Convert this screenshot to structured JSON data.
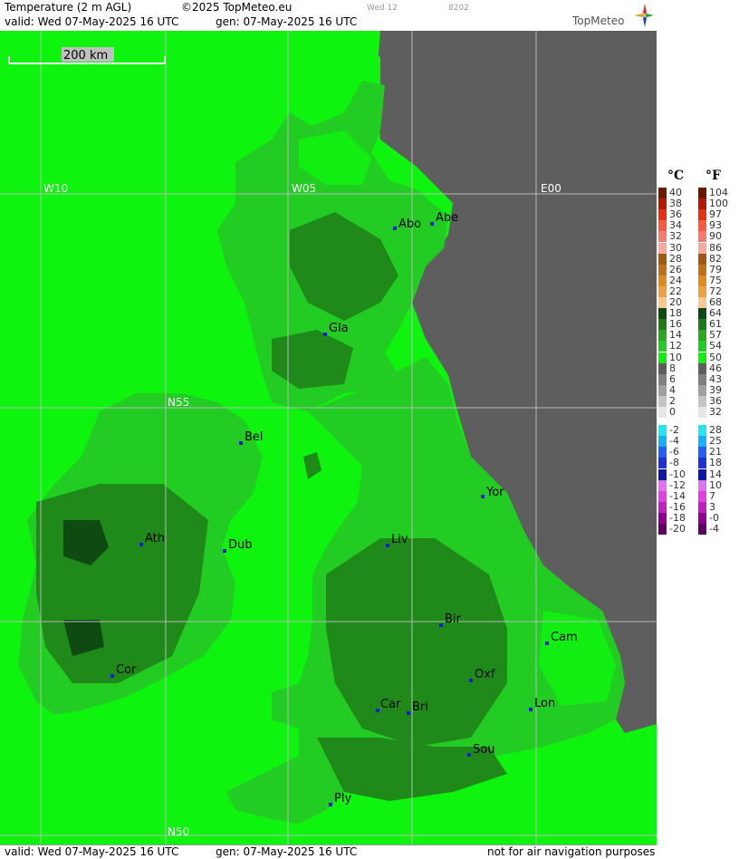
{
  "header": {
    "title": "Temperature (2 m AGL)",
    "copyright": "©2025 TopMeteo.eu",
    "run_small": "Wed 12",
    "code_small": "8202",
    "valid": "valid:  Wed  07-May-2025  16 UTC",
    "gen": "gen: 07-May-2025 16 UTC",
    "brand": "TopMeteo"
  },
  "map": {
    "scale_label": "200 km",
    "grid_labels": {
      "w10": "W10",
      "w05": "W05",
      "e00": "E00",
      "n55": "N55",
      "n50": "N50"
    },
    "cities": [
      {
        "name": "Abo",
        "id": "aberdeen"
      },
      {
        "name": "Abe",
        "id": "aberdeen-east"
      },
      {
        "name": "Gla",
        "id": "glasgow"
      },
      {
        "name": "Bel",
        "id": "belfast"
      },
      {
        "name": "Yor",
        "id": "york"
      },
      {
        "name": "Ath",
        "id": "athlone"
      },
      {
        "name": "Dub",
        "id": "dublin"
      },
      {
        "name": "Liv",
        "id": "liverpool"
      },
      {
        "name": "Bir",
        "id": "birmingham"
      },
      {
        "name": "Cam",
        "id": "cambridge"
      },
      {
        "name": "Oxf",
        "id": "oxford"
      },
      {
        "name": "Cor",
        "id": "cork"
      },
      {
        "name": "Car",
        "id": "cardiff"
      },
      {
        "name": "Bri",
        "id": "bristol"
      },
      {
        "name": "Lon",
        "id": "london"
      },
      {
        "name": "Sou",
        "id": "southampton"
      },
      {
        "name": "Ply",
        "id": "plymouth"
      }
    ]
  },
  "footer": {
    "valid": "valid:  Wed  07-May-2025  16 UTC",
    "gen": "gen: 07-May-2025 16 UTC",
    "note": "not for air navigation purposes"
  },
  "legend": {
    "celsius_unit": "°C",
    "fahrenheit_unit": "°F",
    "celsius": [
      "40",
      "38",
      "36",
      "34",
      "32",
      "30",
      "28",
      "26",
      "24",
      "22",
      "20",
      "18",
      "16",
      "14",
      "12",
      "10",
      "8",
      "6",
      "4",
      "2",
      "0",
      "-2",
      "-4",
      "-6",
      "-8",
      "-10",
      "-12",
      "-14",
      "-16",
      "-18",
      "-20"
    ],
    "fahrenheit": [
      "104",
      "100",
      "97",
      "93",
      "90",
      "86",
      "82",
      "79",
      "75",
      "72",
      "68",
      "64",
      "61",
      "57",
      "54",
      "50",
      "46",
      "43",
      "39",
      "36",
      "32",
      "28",
      "25",
      "21",
      "18",
      "14",
      "10",
      "7",
      "3",
      "-0",
      "-4"
    ],
    "colors": [
      "#6b1a00",
      "#b81800",
      "#e83010",
      "#f85a40",
      "#f87a70",
      "#f8a8a0",
      "#a05a10",
      "#c07018",
      "#e08a20",
      "#f0a040",
      "#f8c890",
      "#0f4a12",
      "#1f7a1a",
      "#2aa820",
      "#22cc22",
      "#12ee12",
      "#5e5e5e",
      "#808080",
      "#a0a0a0",
      "#c4c4c4",
      "#e6e6e6",
      "#20e8f0",
      "#18b0f8",
      "#2060f8",
      "#2030d8",
      "#1018a8",
      "#e070f0",
      "#e040e0",
      "#c020c0",
      "#900090",
      "#600060"
    ]
  },
  "colors": {
    "sea": "#0ff40f",
    "land_bright": "#12ee12",
    "land_mid": "#22cc22",
    "land_dark": "#1f8a1a",
    "land_darkest": "#0f4a12",
    "continent_grey": "#5e5e5e"
  }
}
